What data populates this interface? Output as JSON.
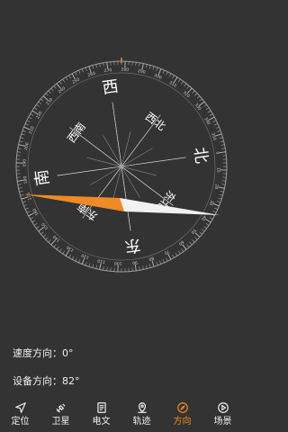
{
  "compass": {
    "directions": {
      "east": "东",
      "south": "南",
      "west": "西",
      "north": "北",
      "northeast": "东北",
      "southeast": "东南",
      "southwest": "西南",
      "northwest": "西北"
    },
    "degree_labels": [
      "0",
      "10",
      "20",
      "30",
      "40",
      "50",
      "60",
      "70",
      "80",
      "90",
      "100",
      "110",
      "120",
      "130",
      "140",
      "150",
      "160",
      "170",
      "180",
      "190",
      "200",
      "210",
      "220",
      "230",
      "240",
      "250",
      "260",
      "270",
      "280",
      "290",
      "300",
      "310",
      "320",
      "330",
      "340",
      "350"
    ],
    "heading_deg": 82,
    "colors": {
      "accent": "#f08a24",
      "needle_white": "#f2f2f2",
      "bg": "#333333"
    }
  },
  "info": {
    "speed_direction_label": "速度方向：",
    "speed_direction_value": "0°",
    "device_direction_label": "设备方向：",
    "device_direction_value": "82°"
  },
  "tabs": [
    {
      "label": "定位",
      "icon": "navigation-arrow-icon"
    },
    {
      "label": "卫星",
      "icon": "satellite-icon"
    },
    {
      "label": "电文",
      "icon": "document-icon"
    },
    {
      "label": "轨迹",
      "icon": "map-pin-icon"
    },
    {
      "label": "方向",
      "icon": "compass-icon",
      "active": true
    },
    {
      "label": "场景",
      "icon": "play-icon"
    }
  ]
}
